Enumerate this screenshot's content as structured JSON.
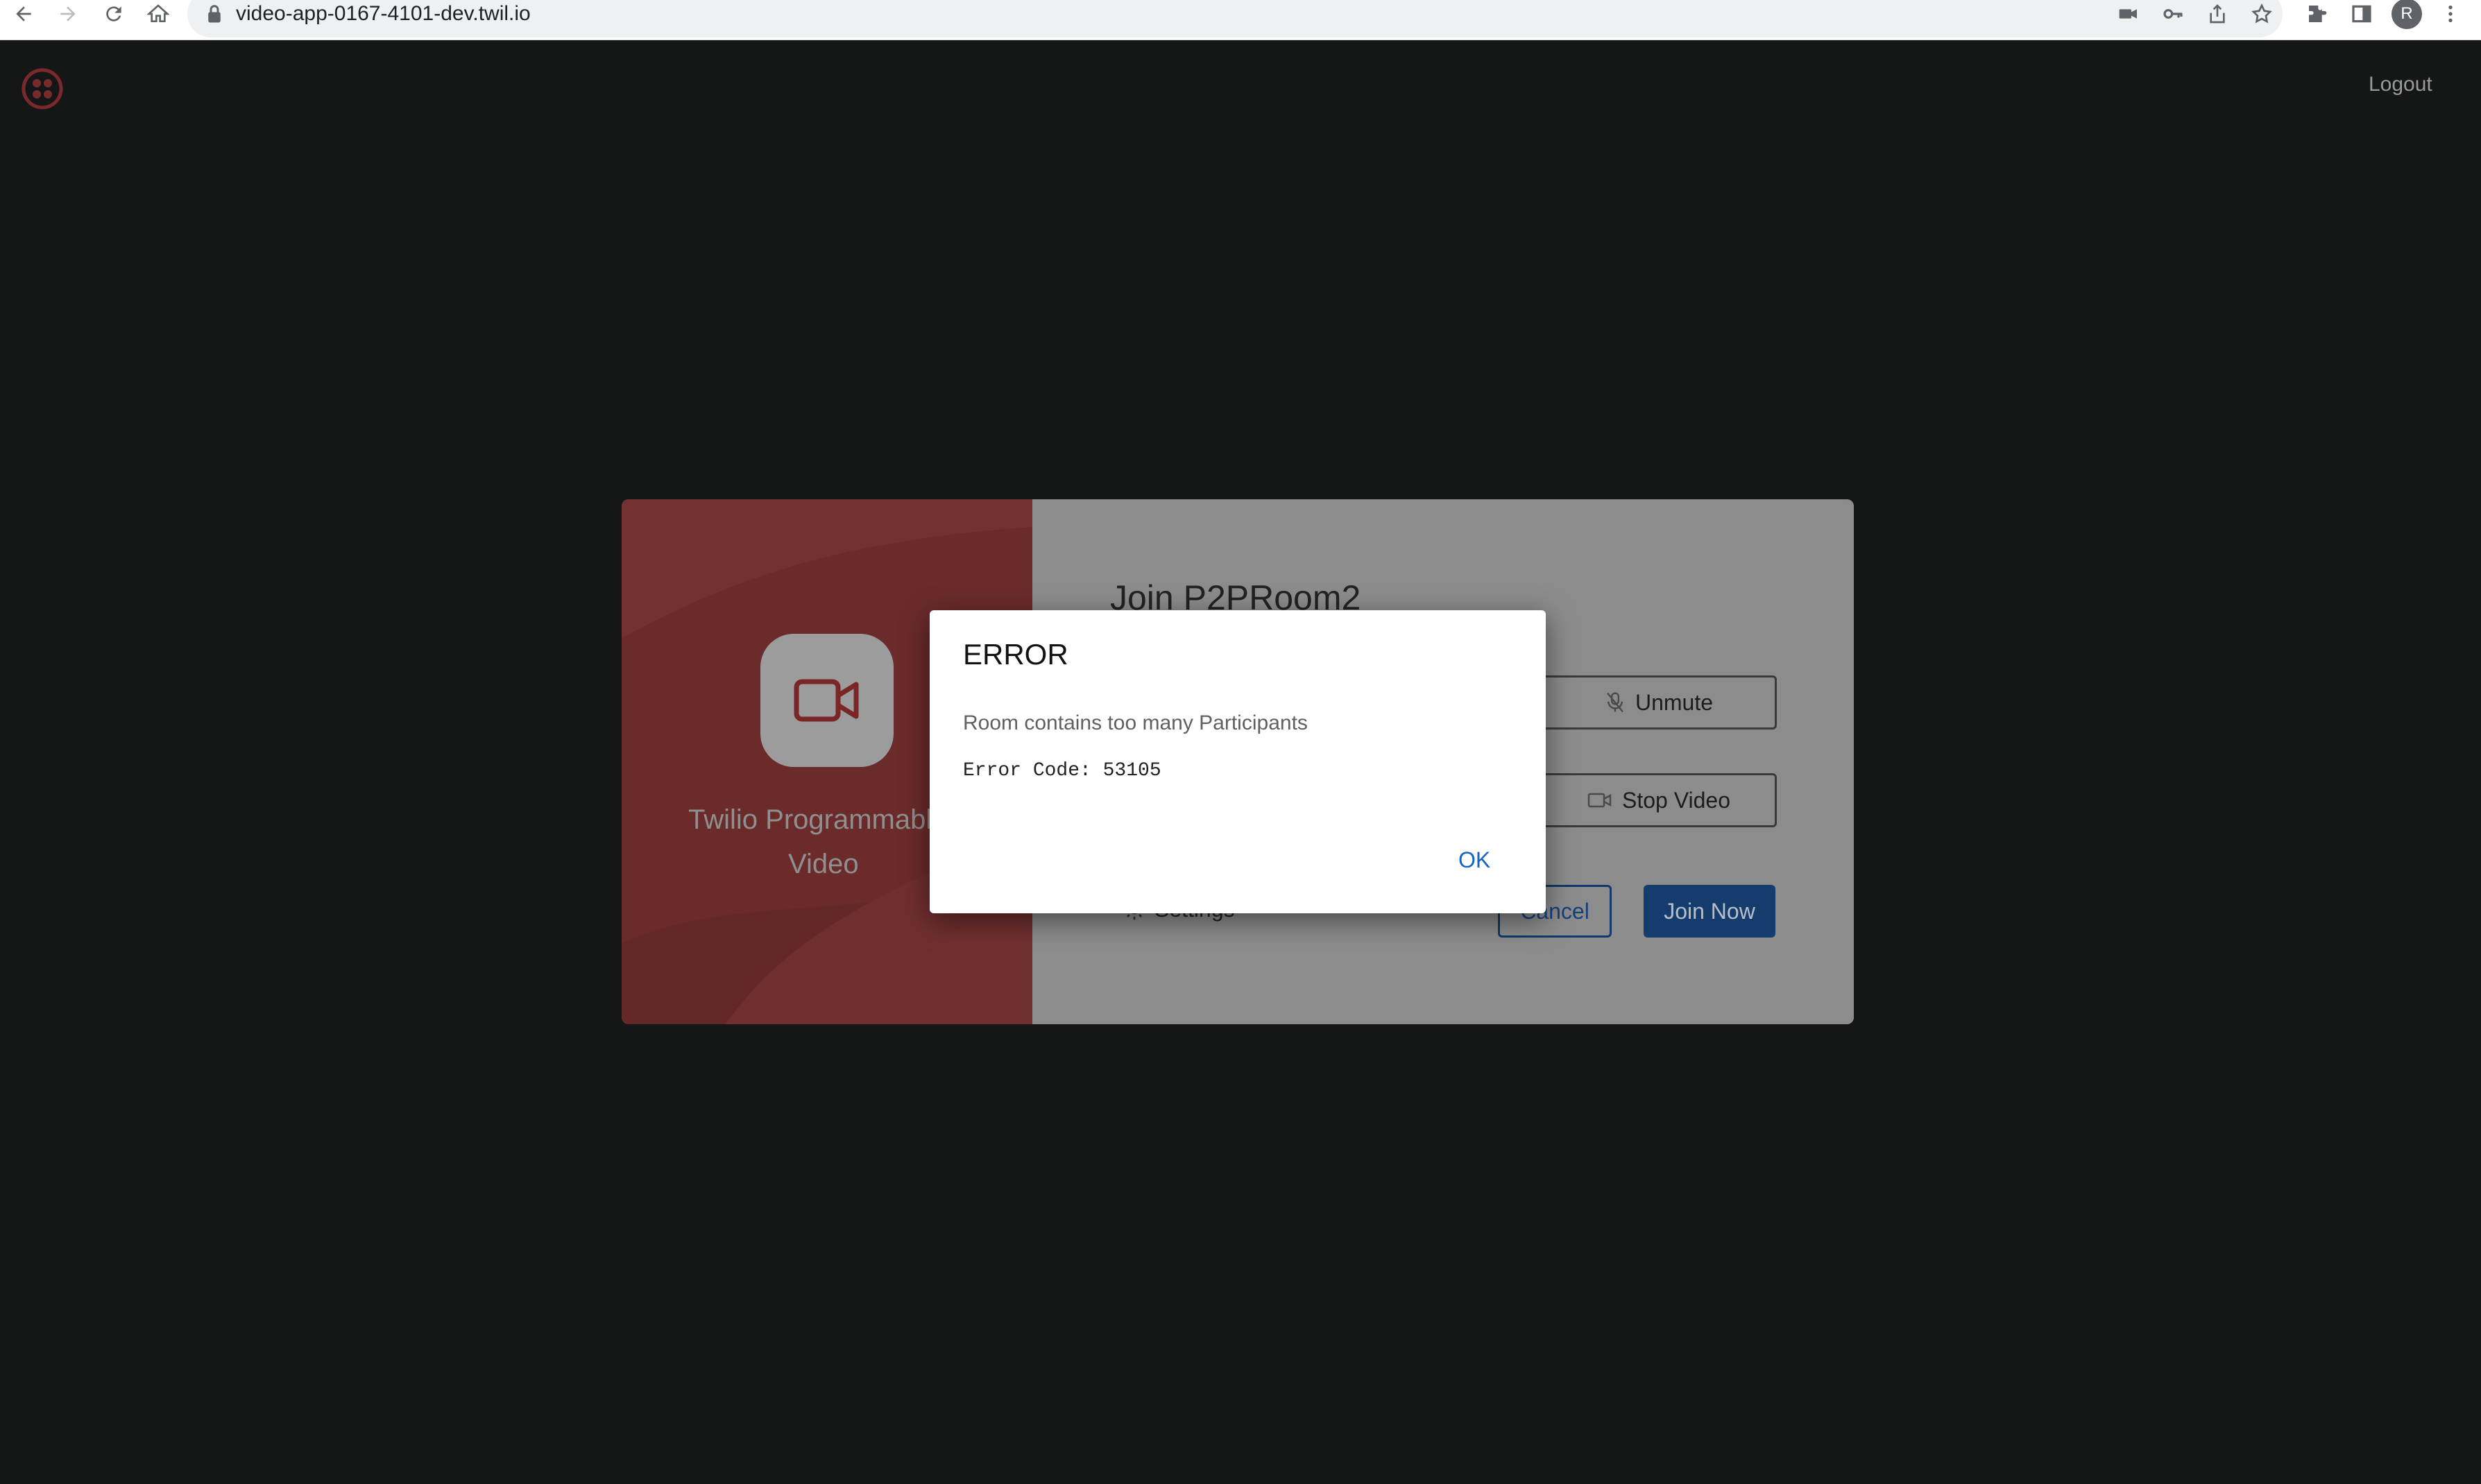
{
  "browser": {
    "url": "video-app-0167-4101-dev.twil.io",
    "profile_initial": "R",
    "icons": [
      "back-icon",
      "forward-icon",
      "reload-icon",
      "home-icon",
      "lock-icon",
      "camera-icon",
      "key-icon",
      "share-icon",
      "star-icon",
      "extensions-icon",
      "sidebar-icon",
      "menu-icon"
    ]
  },
  "header": {
    "logout_label": "Logout"
  },
  "card": {
    "brand_line1": "Twilio Programmable",
    "brand_line2": "Video",
    "title": "Join P2PRoom2",
    "unmute_label": "Unmute",
    "stop_video_label": "Stop Video",
    "settings_label": "Settings",
    "cancel_label": "Cancel",
    "join_label": "Join Now"
  },
  "dialog": {
    "title": "ERROR",
    "message": "Room contains too many Participants",
    "code": "Error Code: 53105",
    "ok_label": "OK"
  },
  "colors": {
    "background": "#151616",
    "brand_red": "#6b2b2b",
    "accent_blue": "#1565c0"
  }
}
